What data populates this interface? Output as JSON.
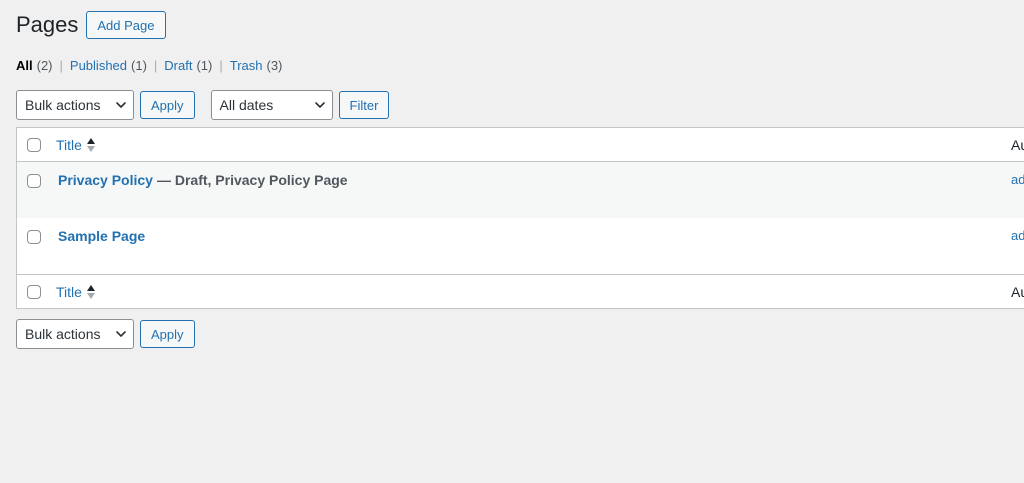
{
  "header": {
    "title": "Pages",
    "add_label": "Add Page"
  },
  "views": {
    "all": {
      "label": "All",
      "count": "(2)"
    },
    "published": {
      "label": "Published",
      "count": "(1)"
    },
    "draft": {
      "label": "Draft",
      "count": "(1)"
    },
    "trash": {
      "label": "Trash",
      "count": "(3)"
    },
    "separator": "|"
  },
  "toolbar_top": {
    "bulk_actions": "Bulk actions",
    "apply_label": "Apply",
    "dates": "All dates",
    "filter_label": "Filter"
  },
  "table": {
    "columns": {
      "title": "Title",
      "author": "Au"
    },
    "rows": [
      {
        "title": "Privacy Policy",
        "state": "— Draft, Privacy Policy Page",
        "author": "ad"
      },
      {
        "title": "Sample Page",
        "state": "",
        "author": "ad"
      }
    ]
  },
  "toolbar_bottom": {
    "bulk_actions": "Bulk actions",
    "apply_label": "Apply"
  },
  "icons": {
    "sort": "sort-arrows-icon",
    "dropdown": "chevron-down-icon"
  },
  "colors": {
    "link": "#2271b1",
    "background": "#f0f0f1",
    "border": "#c3c4c7",
    "alt_row": "#f6f7f7"
  }
}
